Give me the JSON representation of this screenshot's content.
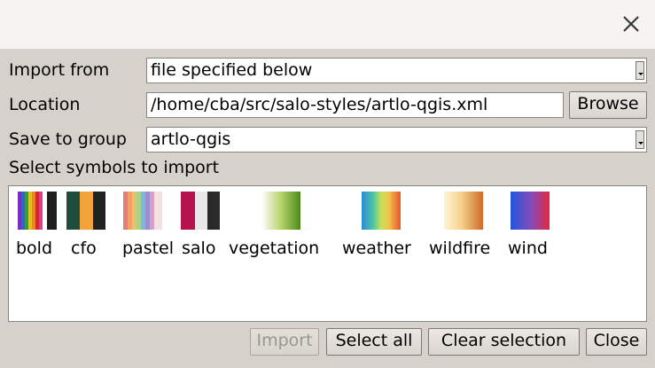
{
  "window": {
    "close_icon": "close-icon"
  },
  "form": {
    "import_from_label": "Import from",
    "import_from_value": "file specified below",
    "location_label": "Location",
    "location_value": "/home/cba/src/salo-styles/artlo-qgis.xml",
    "browse_label": "Browse",
    "save_group_label": "Save to group",
    "save_group_value": "artlo-qgis",
    "select_symbols_label": "Select symbols to import"
  },
  "symbols": [
    {
      "name": "bold"
    },
    {
      "name": "cfo"
    },
    {
      "name": "pastel"
    },
    {
      "name": "salo"
    },
    {
      "name": "vegetation"
    },
    {
      "name": "weather"
    },
    {
      "name": "wildfire"
    },
    {
      "name": "wind"
    }
  ],
  "buttons": {
    "import_label": "Import",
    "import_enabled": false,
    "select_all_label": "Select all",
    "clear_selection_label": "Clear selection",
    "close_label": "Close"
  }
}
